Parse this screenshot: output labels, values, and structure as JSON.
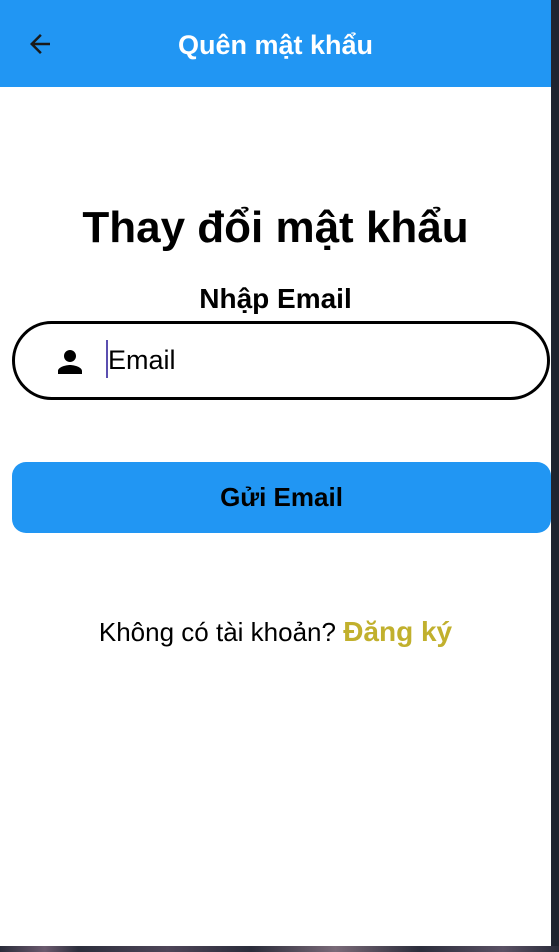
{
  "appbar": {
    "title": "Quên mật khẩu",
    "background": "#2196f3",
    "back_icon": "arrow-back-icon"
  },
  "main": {
    "heading": "Thay đổi mật khẩu",
    "subheading": "Nhập Email",
    "email_field": {
      "icon": "person-icon",
      "placeholder": "Email",
      "value": ""
    },
    "send_button_label": "Gửi Email",
    "send_button_color": "#2196f3",
    "signup_prompt": "Không có tài khoản?",
    "signup_link": "Đăng ký",
    "signup_link_color": "#c1b02d"
  }
}
